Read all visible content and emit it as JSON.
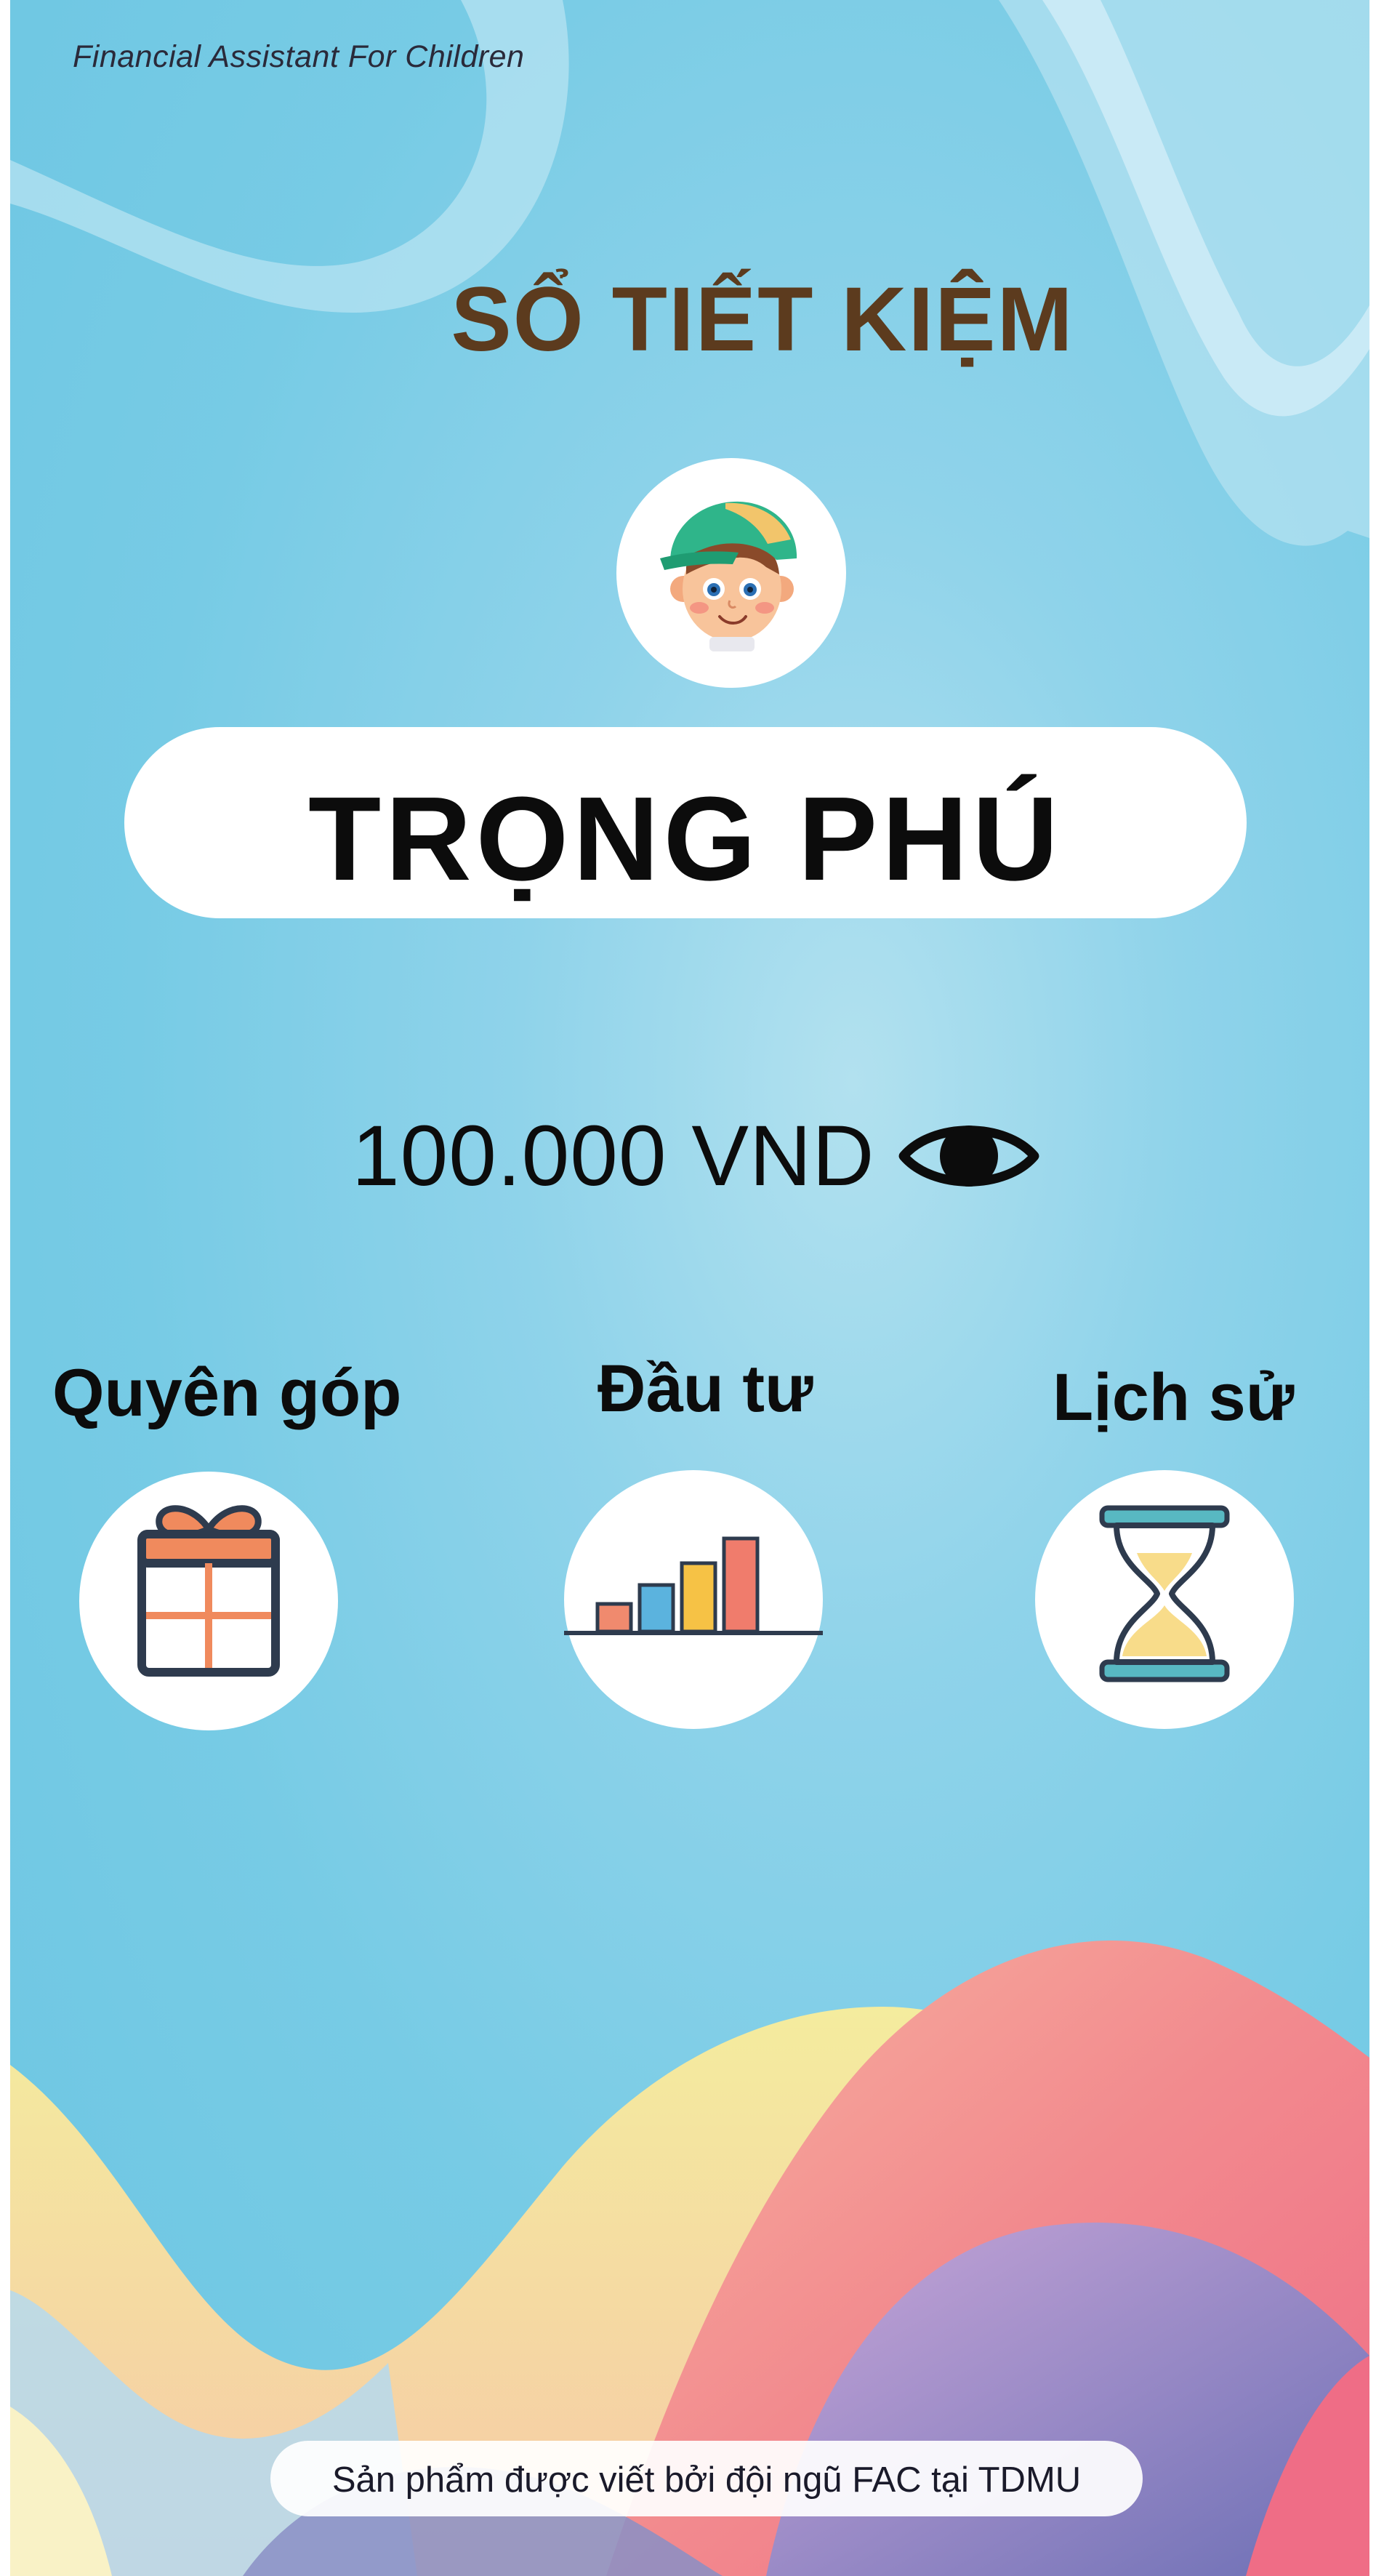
{
  "app": {
    "tagline": "Financial Assistant For Children",
    "page_title": "SỔ TIẾT KIỆM"
  },
  "profile": {
    "avatar_icon": "boy-with-cap-avatar-icon",
    "name": "TRỌNG PHÚ"
  },
  "balance": {
    "amount": "100.000 VND",
    "visibility_icon": "eye-icon"
  },
  "actions": [
    {
      "label": "Quyên góp",
      "icon": "gift-icon"
    },
    {
      "label": "Đầu tư",
      "icon": "bar-chart-icon"
    },
    {
      "label": "Lịch sử",
      "icon": "hourglass-icon"
    }
  ],
  "footer": {
    "credit": "Sản phẩm được viết bởi đội ngũ FAC tại TDMU"
  },
  "colors": {
    "background": "#77cbe5",
    "title": "#5c3b1e",
    "text": "#0c0c0c",
    "card": "#ffffff"
  }
}
